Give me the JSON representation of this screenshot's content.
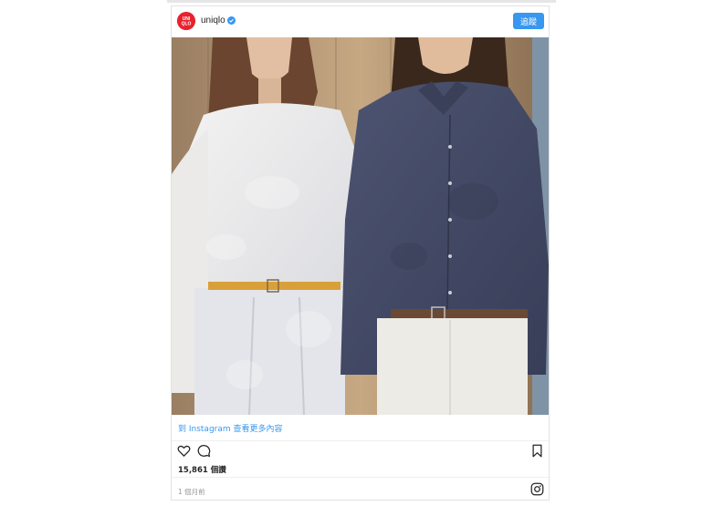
{
  "post": {
    "username": "uniqlo",
    "verified": true,
    "follow_label": "追蹤",
    "avatar_text_top": "UNI",
    "avatar_text_bottom": "QLO",
    "more_link": "到 Instagram 查看更多內容",
    "likes": "15,861 個讚",
    "time_ago": "1 個月前"
  },
  "colors": {
    "accent": "#3897f0",
    "brand_red": "#e8222d",
    "text": "#262626",
    "muted": "#999999"
  },
  "icons": [
    "verified-badge-icon",
    "heart-icon",
    "comment-icon",
    "bookmark-icon",
    "instagram-icon"
  ]
}
